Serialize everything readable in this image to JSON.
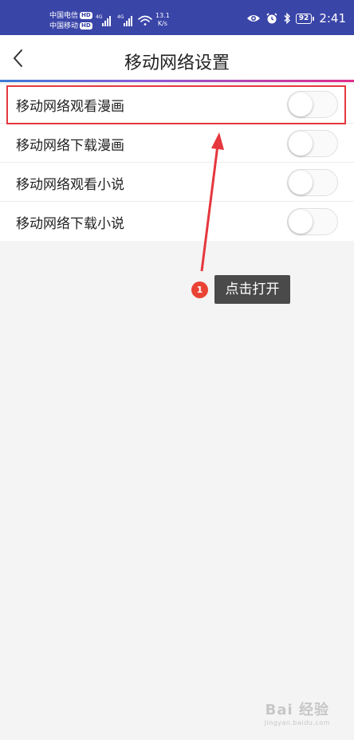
{
  "status_bar": {
    "carrier_1": "中国电信",
    "carrier_2": "中国移动",
    "hd_badge": "HD",
    "network_speed_value": "13.1",
    "network_speed_unit": "K/s",
    "battery_level": "92",
    "time": "2:41"
  },
  "header": {
    "title": "移动网络设置"
  },
  "settings": [
    {
      "label": "移动网络观看漫画",
      "enabled": false
    },
    {
      "label": "移动网络下载漫画",
      "enabled": false
    },
    {
      "label": "移动网络观看小说",
      "enabled": false
    },
    {
      "label": "移动网络下载小说",
      "enabled": false
    }
  ],
  "annotation": {
    "step_number": "1",
    "instruction": "点击打开",
    "highlight_color": "#e5373d"
  },
  "watermark": {
    "brand": "Bai 经验",
    "sub": "jingyan.baidu.com"
  },
  "colors": {
    "status_bar": "#3a45a8",
    "accent_start": "#3a7bd5",
    "accent_end": "#e32c8a",
    "tooltip": "#4a4a4a",
    "step_dot": "#ea4335"
  }
}
